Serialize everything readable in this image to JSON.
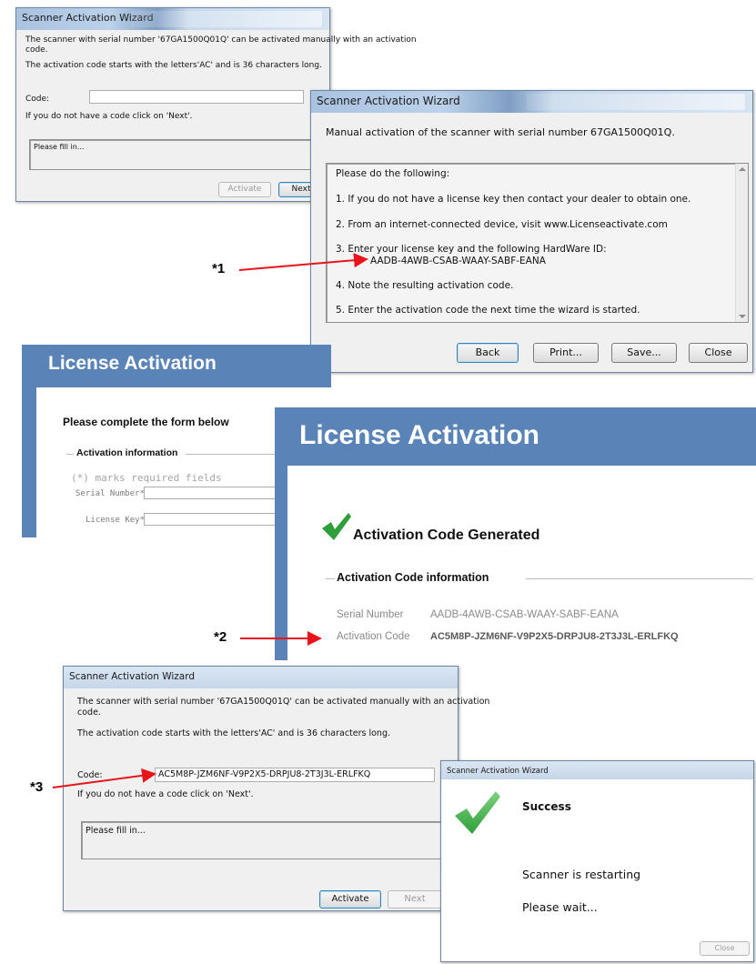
{
  "dialog1": {
    "title": "Scanner Activation Wizard",
    "line1": "The scanner with serial number '67GA1500Q01Q' can be activated manually with an activation",
    "line1b": "code.",
    "line2": "The activation code starts with the letters'AC' and is 36 characters long.",
    "code_label": "Code:",
    "code_value": "",
    "no_code_hint": "If you do not have a code click on 'Next'.",
    "info_text": "Please fill in...",
    "activate_label": "Activate",
    "next_label": "Next"
  },
  "dialog2": {
    "title": "Scanner Activation Wizard",
    "heading": "Manual activation of the scanner with serial number 67GA1500Q01Q.",
    "steps_intro": "Please do the following:",
    "step1": "1. If you do not have a license key then contact your dealer to obtain one.",
    "step2": "2. From an internet-connected device, visit www.Licenseactivate.com",
    "step3": "3. Enter your license key and the following HardWare ID:",
    "hardware_id": "AADB-4AWB-CSAB-WAAY-SABF-EANA",
    "step4": "4. Note the resulting activation code.",
    "step5": "5. Enter the activation code the next time the wizard is started.",
    "back_label": "Back",
    "print_label": "Print...",
    "save_label": "Save...",
    "close_label": "Close"
  },
  "license_form": {
    "title": "License Activation",
    "subtitle": "Please complete the form below",
    "section": "Activation information",
    "required_note": "(*) marks required fields",
    "serial_label": "Serial Number*",
    "license_label": "License Key*"
  },
  "license_result": {
    "title": "License Activation",
    "status": "Activation Code Generated",
    "section": "Activation Code information",
    "serial_label": "Serial Number",
    "serial_value": "AADB-4AWB-CSAB-WAAY-SABF-EANA",
    "code_label": "Activation Code",
    "code_value": "AC5M8P-JZM6NF-V9P2X5-DRPJU8-2T3J3L-ERLFKQ"
  },
  "dialog3": {
    "title": "Scanner Activation Wizard",
    "line1": "The scanner with serial number '67GA1500Q01Q' can be activated manually with an activation",
    "line1b": "code.",
    "line2": "The activation code starts with the letters'AC' and is 36 characters long.",
    "code_label": "Code:",
    "code_value": "AC5M8P-JZM6NF-V9P2X5-DRPJU8-2T3J3L-ERLFKQ",
    "no_code_hint": "If you do not have a code click on 'Next'.",
    "info_text": "Please fill in...",
    "activate_label": "Activate",
    "next_label": "Next"
  },
  "dialog4": {
    "title": "Scanner Activation Wizard",
    "status": "Success",
    "message1": "Scanner is restarting",
    "message2": "Please wait...",
    "close_label": "Close"
  },
  "annotations": {
    "a1": "*1",
    "a2": "*2",
    "a3": "*3"
  },
  "colors": {
    "arrow": "#e8141b",
    "license_blue": "#5a84b7",
    "check_green": "#2e9e3a"
  }
}
